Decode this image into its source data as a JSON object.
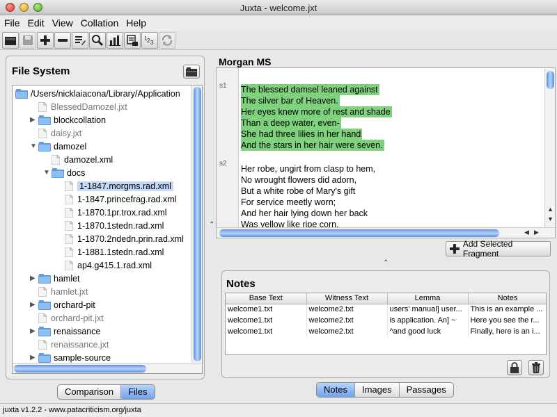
{
  "window": {
    "title": "Juxta - welcome.jxt"
  },
  "menu": [
    "File",
    "Edit",
    "View",
    "Collation",
    "Help"
  ],
  "toolbar": {
    "buttons": [
      {
        "name": "open-folder-icon",
        "enabled": true
      },
      {
        "name": "save-icon",
        "enabled": false
      },
      {
        "name": "add-icon",
        "enabled": true
      },
      {
        "name": "remove-icon",
        "enabled": true
      },
      {
        "name": "edit-document-icon",
        "enabled": true
      },
      {
        "name": "search-icon",
        "enabled": true
      },
      {
        "name": "chart-icon",
        "enabled": true
      },
      {
        "name": "export-icon",
        "enabled": true
      },
      {
        "name": "number-sequence-icon",
        "enabled": true
      },
      {
        "name": "refresh-icon",
        "enabled": false
      }
    ]
  },
  "file_system": {
    "heading": "File System",
    "items": [
      {
        "label": "/Users/nicklaiacona/Library/Application",
        "type": "folder",
        "expand": "open",
        "gray": false,
        "selected": false
      },
      {
        "label": "BlessedDamozel.jxt",
        "type": "file",
        "expand": "",
        "gray": true,
        "selected": false
      },
      {
        "label": "blockcollation",
        "type": "folder",
        "expand": "closed",
        "gray": false,
        "selected": false
      },
      {
        "label": "daisy.jxt",
        "type": "file",
        "expand": "",
        "gray": true,
        "selected": false
      },
      {
        "label": "damozel",
        "type": "folder",
        "expand": "open",
        "gray": false,
        "selected": false
      },
      {
        "label": "damozel.xml",
        "type": "file",
        "expand": "",
        "gray": false,
        "selected": false
      },
      {
        "label": "docs",
        "type": "folder",
        "expand": "open",
        "gray": false,
        "selected": false
      },
      {
        "label": "1-1847.morgms.rad.xml",
        "type": "file",
        "expand": "",
        "gray": false,
        "selected": true
      },
      {
        "label": "1-1847.princefrag.rad.xml",
        "type": "file",
        "expand": "",
        "gray": false,
        "selected": false
      },
      {
        "label": "1-1870.1pr.trox.rad.xml",
        "type": "file",
        "expand": "",
        "gray": false,
        "selected": false
      },
      {
        "label": "1-1870.1stedn.rad.xml",
        "type": "file",
        "expand": "",
        "gray": false,
        "selected": false
      },
      {
        "label": "1-1870.2ndedn.prin.rad.xml",
        "type": "file",
        "expand": "",
        "gray": false,
        "selected": false
      },
      {
        "label": "1-1881.1stedn.rad.xml",
        "type": "file",
        "expand": "",
        "gray": false,
        "selected": false
      },
      {
        "label": "ap4.g415.1.rad.xml",
        "type": "file",
        "expand": "",
        "gray": false,
        "selected": false
      },
      {
        "label": "hamlet",
        "type": "folder",
        "expand": "closed",
        "gray": false,
        "selected": false
      },
      {
        "label": "hamlet.jxt",
        "type": "file",
        "expand": "",
        "gray": true,
        "selected": false
      },
      {
        "label": "orchard-pit",
        "type": "folder",
        "expand": "closed",
        "gray": false,
        "selected": false
      },
      {
        "label": "orchard-pit.jxt",
        "type": "file",
        "expand": "",
        "gray": true,
        "selected": false
      },
      {
        "label": "renaissance",
        "type": "folder",
        "expand": "closed",
        "gray": false,
        "selected": false
      },
      {
        "label": "renaissance.jxt",
        "type": "file",
        "expand": "",
        "gray": true,
        "selected": false
      },
      {
        "label": "sample-source",
        "type": "folder",
        "expand": "closed",
        "gray": false,
        "selected": false
      }
    ]
  },
  "left_tabs": {
    "items": [
      "Comparison",
      "Files"
    ],
    "active": "Files"
  },
  "document": {
    "title": "Morgan MS",
    "segments": [
      "s1",
      "s2"
    ],
    "lines": [
      {
        "text": "The blessed damsel leaned against",
        "highlight": true
      },
      {
        "text": "The silver bar of Heaven.",
        "highlight": true
      },
      {
        "text": "Her eyes knew more of rest and shade",
        "highlight": true
      },
      {
        "text": "Than a deep water, even-",
        "highlight": true
      },
      {
        "text": "She had three lilies in her hand",
        "highlight": true
      },
      {
        "text": "And the stars in her hair were seven.",
        "highlight": true
      },
      {
        "text": "Her robe, ungirt from clasp to hem,",
        "highlight": false
      },
      {
        "text": "No wrought flowers did adorn,",
        "highlight": false
      },
      {
        "text": "But a white robe of Mary's gift",
        "highlight": false
      },
      {
        "text": "For service meetly worn;",
        "highlight": false
      },
      {
        "text": "And her hair lying down her back",
        "highlight": false
      },
      {
        "text": "Was yellow like ripe corn.",
        "highlight": false
      }
    ]
  },
  "add_fragment": {
    "label": "Add Selected Fragment"
  },
  "notes": {
    "heading": "Notes",
    "columns": [
      "Base Text",
      "Witness Text",
      "Lemma",
      "Notes"
    ],
    "rows": [
      [
        "welcome1.txt",
        "welcome2.txt",
        "users' manual] user...",
        "This is an example ..."
      ],
      [
        "welcome1.txt",
        "welcome2.txt",
        "is application.  An] ~",
        "Here you see the r..."
      ],
      [
        "welcome1.txt",
        "welcome2.txt",
        "^and good luck",
        "Finally, here is an i..."
      ]
    ]
  },
  "bottom_tabs": {
    "items": [
      "Notes",
      "Images",
      "Passages"
    ],
    "active": "Notes"
  },
  "status": {
    "text": "juxta v1.2.2 - www.patacriticism.org/juxta"
  },
  "colors": {
    "highlight": "#7fd27d",
    "selection": "#c4d7f5",
    "accent": "#6fa4ea"
  }
}
